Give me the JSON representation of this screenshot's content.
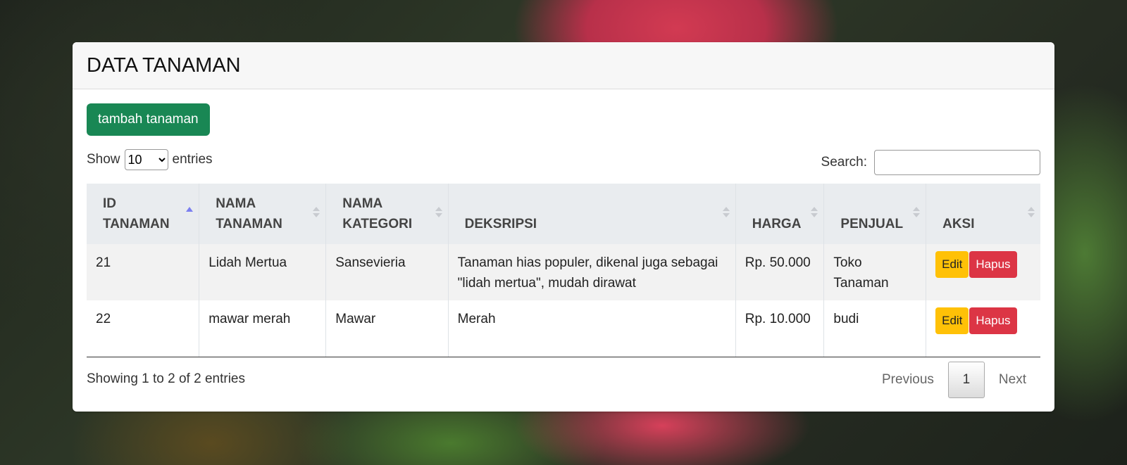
{
  "card": {
    "title": "DATA TANAMAN"
  },
  "toolbar": {
    "add_label": "tambah tanaman"
  },
  "length": {
    "prefix": "Show",
    "selected": "10",
    "suffix": "entries"
  },
  "search": {
    "label": "Search:",
    "value": ""
  },
  "table": {
    "headers": [
      "ID TANAMAN",
      "NAMA TANAMAN",
      "NAMA KATEGORI",
      "DEKSRIPSI",
      "HARGA",
      "PENJUAL",
      "AKSI"
    ],
    "sort_active_color": "#7b7ff0",
    "rows": [
      {
        "id": "21",
        "nama": "Lidah Mertua",
        "kategori": "Sansevieria",
        "deskripsi": "Tanaman hias populer, dikenal juga sebagai \"lidah mertua\", mudah dirawat",
        "harga": "Rp. 50.000",
        "penjual": "Toko Tanaman",
        "edit_label": "Edit",
        "hapus_label": "Hapus"
      },
      {
        "id": "22",
        "nama": "mawar merah",
        "kategori": "Mawar",
        "deskripsi": "Merah",
        "harga": "Rp. 10.000",
        "penjual": "budi",
        "edit_label": "Edit",
        "hapus_label": "Hapus"
      }
    ]
  },
  "footer": {
    "info": "Showing 1 to 2 of 2 entries",
    "previous": "Previous",
    "current_page": "1",
    "next": "Next"
  },
  "colors": {
    "primary_green": "#198754",
    "edit_yellow": "#ffc107",
    "delete_red": "#dc3545"
  }
}
